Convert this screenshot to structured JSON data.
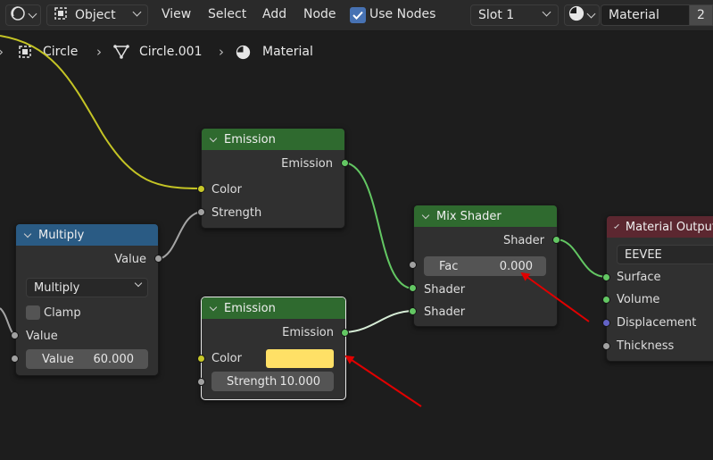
{
  "header": {
    "mode_label": "Object",
    "menu": [
      "View",
      "Select",
      "Add",
      "Node"
    ],
    "use_nodes_label": "Use Nodes",
    "use_nodes_checked": true,
    "slot_label": "Slot 1",
    "material_name": "Material",
    "material_users": "2"
  },
  "breadcrumb": {
    "items": [
      "Circle",
      "Circle.001",
      "Material"
    ]
  },
  "nodes": {
    "emission_top": {
      "title": "Emission",
      "output": "Emission",
      "inputs": [
        "Color",
        "Strength"
      ]
    },
    "multiply": {
      "title": "Multiply",
      "output": "Value",
      "operation": "Multiply",
      "clamp_label": "Clamp",
      "clamp_checked": false,
      "input_label": "Value",
      "value_field_label": "Value",
      "value_field_value": "60.000"
    },
    "emission_bottom": {
      "title": "Emission",
      "output": "Emission",
      "color_label": "Color",
      "color_swatch": "#ffe066",
      "strength_label": "Strength",
      "strength_value": "10.000"
    },
    "mix_shader": {
      "title": "Mix Shader",
      "output": "Shader",
      "fac_label": "Fac",
      "fac_value": "0.000",
      "inputs": [
        "Shader",
        "Shader"
      ]
    },
    "material_output": {
      "title": "Material Output",
      "target": "EEVEE",
      "inputs": [
        "Surface",
        "Volume",
        "Displacement",
        "Thickness"
      ]
    }
  },
  "colors": {
    "node_header_shader": "#2f6a2f",
    "node_header_converter": "#2a5b84",
    "node_header_output": "#5c2730",
    "socket_shader": "#63c763",
    "socket_float": "#a1a1a1",
    "socket_color": "#c7c729",
    "socket_vector": "#6363c7",
    "annotation_arrow": "#e00000"
  }
}
